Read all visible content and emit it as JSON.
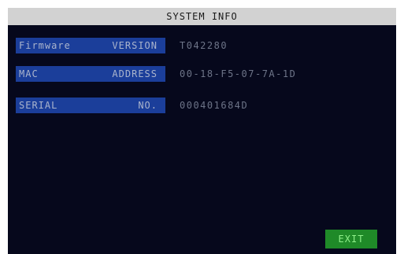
{
  "title": "SYSTEM INFO",
  "rows": [
    {
      "label_left": "Firmware",
      "label_right": "VERSION",
      "value": "T042280"
    },
    {
      "label_left": "MAC",
      "label_right": "ADDRESS",
      "value": "00-18-F5-07-7A-1D"
    },
    {
      "label_left": "SERIAL",
      "label_right": "NO.",
      "value": "000401684D"
    }
  ],
  "exit_label": "EXIT",
  "colors": {
    "screen_bg": "#06081c",
    "title_bg": "#d2d2d2",
    "label_bg": "#1b3e9a",
    "exit_bg": "#1f8a28"
  }
}
